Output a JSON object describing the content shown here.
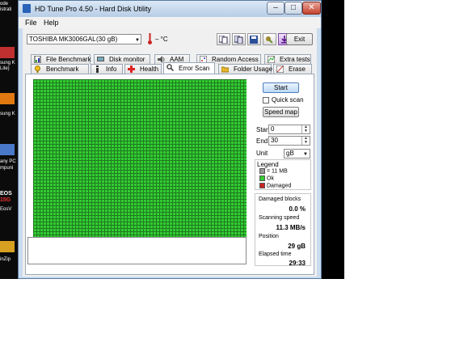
{
  "desktop": {
    "fragments": [
      {
        "text": "ode"
      },
      {
        "text": "istrati"
      },
      {
        "text": "sung K"
      },
      {
        "text": "Lite)"
      },
      {
        "text": "sung K"
      },
      {
        "text": "any PC"
      },
      {
        "text": "mpuni"
      },
      {
        "text": "EOS"
      },
      {
        "text": "15G"
      },
      {
        "text": "EosV"
      },
      {
        "text": "inZip"
      }
    ]
  },
  "window": {
    "title": "HD Tune Pro 4.50 - Hard Disk Utility",
    "controls": {
      "minimize": "–",
      "maximize": "□",
      "close": "✕"
    }
  },
  "menu": {
    "file": "File",
    "help": "Help"
  },
  "toolbar": {
    "drive": "TOSHIBA MK3006GAL",
    "drive_size": "(30 gB)",
    "temperature": "– °C",
    "exit_label": "Exit"
  },
  "tabs": {
    "row1": [
      {
        "label": "File Benchmark",
        "icon": "file-benchmark-icon"
      },
      {
        "label": "Disk monitor",
        "icon": "disk-monitor-icon"
      },
      {
        "label": "AAM",
        "icon": "speaker-icon"
      },
      {
        "label": "Random Access",
        "icon": "random-access-icon"
      },
      {
        "label": "Extra tests",
        "icon": "extra-tests-icon"
      }
    ],
    "row2": [
      {
        "label": "Benchmark",
        "icon": "benchmark-icon"
      },
      {
        "label": "Info",
        "icon": "info-icon"
      },
      {
        "label": "Health",
        "icon": "health-icon"
      },
      {
        "label": "Error Scan",
        "icon": "search-icon"
      },
      {
        "label": "Folder Usage",
        "icon": "folder-icon"
      },
      {
        "label": "Erase",
        "icon": "erase-icon"
      }
    ],
    "active": "Error Scan"
  },
  "scan": {
    "start_label": "Start",
    "quick_scan_label": "Quick scan",
    "quick_scan_checked": false,
    "speed_map_label": "Speed map",
    "start_field_label": "Start",
    "start_value": "0",
    "end_field_label": "End",
    "end_value": "30",
    "unit_label": "Unit",
    "unit_value": "gB",
    "block_status": "ok",
    "legend": {
      "title": "Legend",
      "block_size": "= 11 MB",
      "ok": "Ok",
      "damaged": "Damaged",
      "ok_color": "#33cc33",
      "damaged_color": "#cc2222"
    },
    "stats": {
      "damaged_blocks_label": "Damaged blocks",
      "damaged_blocks_value": "0.0 %",
      "scanning_speed_label": "Scanning speed",
      "scanning_speed_value": "11.3 MB/s",
      "position_label": "Position",
      "position_value": "29 gB",
      "elapsed_label": "Elapsed time",
      "elapsed_value": "29:33"
    }
  }
}
